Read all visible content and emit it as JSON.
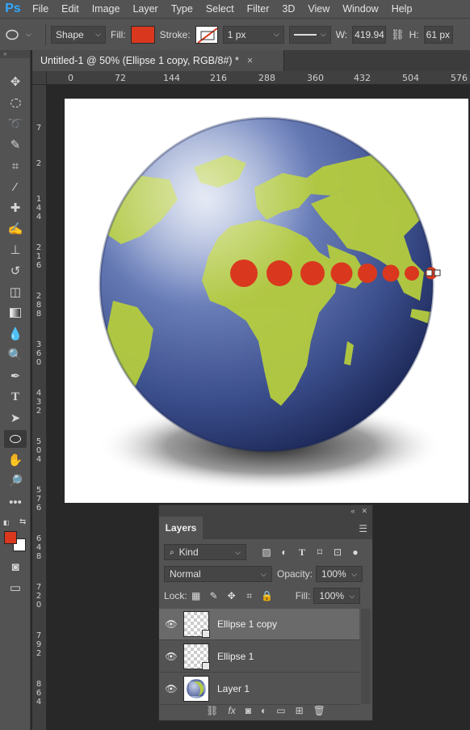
{
  "app": {
    "logo": "Ps"
  },
  "menu": [
    "File",
    "Edit",
    "Image",
    "Layer",
    "Type",
    "Select",
    "Filter",
    "3D",
    "View",
    "Window",
    "Help"
  ],
  "options": {
    "mode": "Shape",
    "fill_label": "Fill:",
    "fill_color": "#d9381e",
    "stroke_label": "Stroke:",
    "stroke_width": "1 px",
    "w_label": "W:",
    "w_value": "419.94",
    "h_label": "H:",
    "h_value": "61 px"
  },
  "document": {
    "tab_title": "Untitled-1 @ 50% (Ellipse 1 copy, RGB/8#) *",
    "close_glyph": "×"
  },
  "ruler_top": [
    "0",
    "72",
    "144",
    "216",
    "288",
    "360",
    "432",
    "504",
    "576"
  ],
  "ruler_left": [
    "7",
    "2",
    "1 4 4",
    "2 1 6",
    "2 8 8",
    "3 6 0",
    "4 3 2",
    "5 0 4",
    "5 7 6",
    "6 4 8",
    "7 2 0",
    "7 9 2",
    "8 6 4"
  ],
  "colors": {
    "foreground": "#d9381e",
    "background": "#ffffff",
    "dot": "#d9381e",
    "land": "#b5cc3f",
    "ocean": "#3a4f8a"
  },
  "layers_panel": {
    "tab": "Layers",
    "filter_kind": "Kind",
    "blend_mode": "Normal",
    "opacity_label": "Opacity:",
    "opacity_value": "100%",
    "lock_label": "Lock:",
    "fill_label": "Fill:",
    "fill_value": "100%",
    "layers": [
      {
        "name": "Ellipse 1 copy",
        "selected": true
      },
      {
        "name": "Ellipse 1",
        "selected": false
      },
      {
        "name": "Layer 1",
        "selected": false
      }
    ],
    "bottom_fx": "fx"
  }
}
